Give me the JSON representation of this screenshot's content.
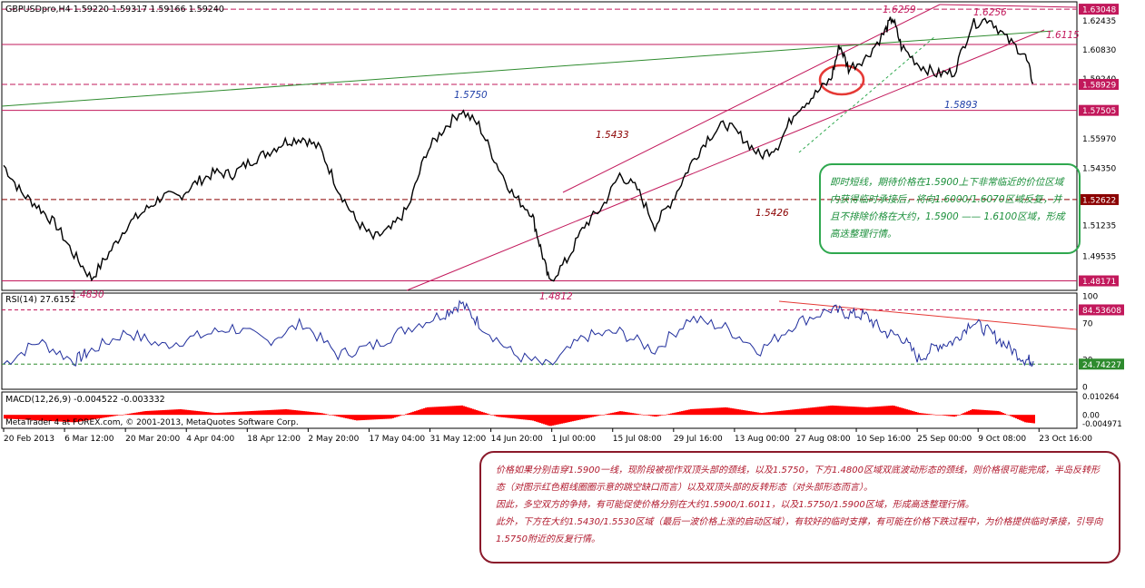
{
  "chart_data": [
    {
      "type": "line",
      "panel": "price",
      "symbol_line": "GBPUSDpro,H4  1.59220 1.59317 1.59166 1.59240",
      "y_ticks": [
        "1.63048",
        "1.62435",
        "1.60830",
        "1.59240",
        "1.58929",
        "1.57505",
        "1.55970",
        "1.54350",
        "1.52622",
        "1.51235",
        "1.49535",
        "1.48171"
      ],
      "x_ticks": [
        "20 Feb 2013",
        "6 Mar 12:00",
        "20 Mar 20:00",
        "4 Apr 04:00",
        "18 Apr 12:00",
        "2 May 20:00",
        "17 May 04:00",
        "31 May 12:00",
        "14 Jun 20:00",
        "1 Jul 00:00",
        "15 Jul 08:00",
        "29 Jul 16:00",
        "13 Aug 00:00",
        "27 Aug 08:00",
        "10 Sep 16:00",
        "25 Sep 00:00",
        "9 Oct 08:00",
        "23 Oct 16:00"
      ],
      "ylim": [
        1.4775,
        1.6335
      ],
      "series_points": [
        [
          0,
          1.545
        ],
        [
          2,
          1.53
        ],
        [
          4,
          1.522
        ],
        [
          6,
          1.512
        ],
        [
          8,
          1.496
        ],
        [
          10,
          1.483
        ],
        [
          12,
          1.497
        ],
        [
          14,
          1.512
        ],
        [
          16,
          1.52
        ],
        [
          18,
          1.528
        ],
        [
          20,
          1.528
        ],
        [
          22,
          1.536
        ],
        [
          24,
          1.541
        ],
        [
          26,
          1.54
        ],
        [
          28,
          1.547
        ],
        [
          30,
          1.552
        ],
        [
          32,
          1.558
        ],
        [
          34,
          1.56
        ],
        [
          36,
          1.554
        ],
        [
          38,
          1.532
        ],
        [
          40,
          1.515
        ],
        [
          42,
          1.505
        ],
        [
          44,
          1.51
        ],
        [
          46,
          1.522
        ],
        [
          48,
          1.552
        ],
        [
          50,
          1.565
        ],
        [
          52,
          1.575
        ],
        [
          54,
          1.567
        ],
        [
          56,
          1.546
        ],
        [
          58,
          1.528
        ],
        [
          60,
          1.519
        ],
        [
          61,
          1.5
        ],
        [
          62,
          1.4812
        ],
        [
          64,
          1.493
        ],
        [
          66,
          1.512
        ],
        [
          68,
          1.522
        ],
        [
          70,
          1.54
        ],
        [
          72,
          1.532
        ],
        [
          74,
          1.512
        ],
        [
          76,
          1.526
        ],
        [
          78,
          1.545
        ],
        [
          80,
          1.56
        ],
        [
          82,
          1.568
        ],
        [
          84,
          1.56
        ],
        [
          86,
          1.55
        ],
        [
          88,
          1.556
        ],
        [
          90,
          1.575
        ],
        [
          92,
          1.583
        ],
        [
          94,
          1.592
        ],
        [
          95,
          1.611
        ],
        [
          96,
          1.598
        ],
        [
          98,
          1.604
        ],
        [
          100,
          1.617
        ],
        [
          101,
          1.6259
        ],
        [
          102,
          1.61
        ],
        [
          104,
          1.6
        ],
        [
          106,
          1.595
        ],
        [
          108,
          1.596
        ],
        [
          110,
          1.622
        ],
        [
          112,
          1.6256
        ],
        [
          114,
          1.614
        ],
        [
          116,
          1.606
        ],
        [
          117,
          1.59
        ]
      ],
      "lines": [
        {
          "label": "1.63048",
          "value": 1.63048,
          "color": "#c2185b",
          "style": "dashed"
        },
        {
          "label": "1.61115",
          "value": 1.61115,
          "color": "#c2185b",
          "style": "solid"
        },
        {
          "label": "1.58929",
          "value": 1.58929,
          "color": "#c2185b",
          "style": "dashed"
        },
        {
          "label": "1.57505",
          "value": 1.57505,
          "color": "#c2185b",
          "style": "solid"
        },
        {
          "label": "1.52622",
          "value": 1.52622,
          "color": "#8b0000",
          "style": "dashed"
        },
        {
          "label": "1.48171",
          "value": 1.48171,
          "color": "#c2185b",
          "style": "solid"
        }
      ],
      "annotations": [
        {
          "text": "1.6259",
          "color": "#c2185b"
        },
        {
          "text": "1.6256",
          "color": "#c2185b"
        },
        {
          "text": "1.6115",
          "color": "#c2185b"
        },
        {
          "text": "1.5750",
          "color": "#1f3fa8"
        },
        {
          "text": "1.5893",
          "color": "#1f3fa8"
        },
        {
          "text": "1.5433",
          "color": "#8b0000"
        },
        {
          "text": "1.5426",
          "color": "#8b0000"
        },
        {
          "text": "1.4830",
          "color": "#c2185b"
        },
        {
          "text": "1.4812",
          "color": "#c2185b"
        }
      ]
    },
    {
      "type": "line",
      "panel": "rsi",
      "label": "RSI(14) 27.6152",
      "y_ticks": [
        "100",
        "84.53608",
        "70",
        "30",
        "24.74227",
        "0"
      ],
      "ylim": [
        0,
        100
      ],
      "levels": [
        84.53608,
        24.74227
      ],
      "series_points": [
        [
          0,
          25
        ],
        [
          4,
          50
        ],
        [
          8,
          28
        ],
        [
          10,
          40
        ],
        [
          14,
          60
        ],
        [
          18,
          45
        ],
        [
          22,
          55
        ],
        [
          26,
          65
        ],
        [
          30,
          50
        ],
        [
          34,
          70
        ],
        [
          38,
          35
        ],
        [
          42,
          45
        ],
        [
          46,
          65
        ],
        [
          50,
          80
        ],
        [
          52,
          92
        ],
        [
          54,
          70
        ],
        [
          58,
          35
        ],
        [
          62,
          22
        ],
        [
          66,
          55
        ],
        [
          70,
          60
        ],
        [
          74,
          40
        ],
        [
          78,
          75
        ],
        [
          82,
          65
        ],
        [
          86,
          40
        ],
        [
          90,
          70
        ],
        [
          94,
          85
        ],
        [
          96,
          80
        ],
        [
          98,
          78
        ],
        [
          100,
          60
        ],
        [
          102,
          55
        ],
        [
          104,
          30
        ],
        [
          106,
          45
        ],
        [
          108,
          50
        ],
        [
          110,
          72
        ],
        [
          112,
          60
        ],
        [
          114,
          45
        ],
        [
          116,
          30
        ],
        [
          117,
          28
        ]
      ]
    },
    {
      "type": "bar",
      "panel": "macd",
      "label": "MACD(12,26,9) -0.004522 -0.003332",
      "y_ticks": [
        "0.010264",
        "0.00",
        "-0.004971"
      ],
      "ylim": [
        -0.0062,
        0.0112
      ],
      "series_points": [
        [
          0,
          -0.002
        ],
        [
          4,
          -0.003
        ],
        [
          8,
          -0.004
        ],
        [
          12,
          -0.001
        ],
        [
          16,
          0.002
        ],
        [
          20,
          0.003
        ],
        [
          24,
          0.001
        ],
        [
          28,
          0.002
        ],
        [
          32,
          0.003
        ],
        [
          36,
          0.001
        ],
        [
          40,
          -0.003
        ],
        [
          44,
          -0.002
        ],
        [
          48,
          0.004
        ],
        [
          52,
          0.005
        ],
        [
          56,
          -0.001
        ],
        [
          60,
          -0.003
        ],
        [
          62,
          -0.006
        ],
        [
          66,
          -0.002
        ],
        [
          70,
          0.002
        ],
        [
          74,
          -0.001
        ],
        [
          78,
          0.003
        ],
        [
          82,
          0.004
        ],
        [
          86,
          0.001
        ],
        [
          90,
          0.003
        ],
        [
          94,
          0.005
        ],
        [
          98,
          0.004
        ],
        [
          101,
          0.005
        ],
        [
          104,
          0.001
        ],
        [
          108,
          -0.001
        ],
        [
          110,
          0.003
        ],
        [
          113,
          0.002
        ],
        [
          116,
          -0.004
        ],
        [
          117,
          -0.0045
        ]
      ]
    }
  ],
  "copyright": "MetaTrader 4 at FOREX.com, © 2001-2013, MetaQuotes Software Corp.",
  "notes": {
    "short_term": "即时短线，期待价格在1.5900上下非常临近的价位区域内获得临时承接后，将向1.6000/1.6070区域反复，并且不排除价格在大约，1.5900 —— 1.6100区域，形成高迭整理行情。",
    "main": [
      "价格如果分别击穿1.5900一线，现阶段被视作双顶头部的颈线，以及1.5750，下方1.4800区域双底波动形态的颈线，则价格很可能完成，半岛反转形态（对图示红色粗线圈圈示意的跳空缺口而言）以及双顶头部的反转形态（对头部形态而言）。",
      "因此，多空双方的争持，有可能促使价格分别在大约1.5900/1.6011，以及1.5750/1.5900区域，形成高迭整理行情。",
      "此外，下方在大约1.5430/1.5530区域（最后一波价格上涨的启动区域），有较好的临时支撑，有可能在价格下跌过程中，为价格提供临时承接，引导向1.5750附近的反复行情。"
    ]
  }
}
